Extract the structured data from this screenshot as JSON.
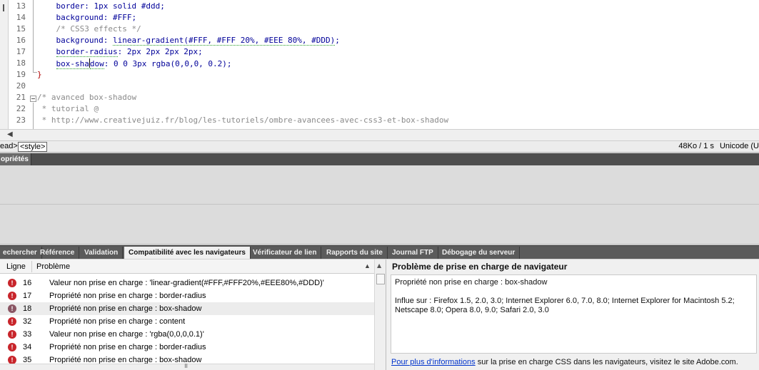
{
  "editor": {
    "line_numbers": [
      "13",
      "14",
      "15",
      "16",
      "17",
      "18",
      "19",
      "20",
      "21",
      "22",
      "23"
    ],
    "lines": {
      "l13": {
        "prop": "border",
        "rest": ": 1px solid #ddd;"
      },
      "l14": {
        "prop": "background",
        "rest": ": #FFF;"
      },
      "l15": {
        "comment": "/* CSS3 effects */"
      },
      "l16": {
        "prop": "background",
        "sep": ": ",
        "squiggle": "linear-gradient(#FFF, #FFF 20%, #EEE 80%, #DDD)",
        "end": ";"
      },
      "l17": {
        "prop": "border-radius",
        "rest": ": 2px 2px 2px 2px;"
      },
      "l18": {
        "prop_a": "box-sha",
        "prop_b": "dow",
        "rest": ": 0 0 3px rgba(0,0,0, 0.2);"
      },
      "l19": {
        "brace": "}"
      },
      "l21": {
        "comment": "/* avanced box-shadow"
      },
      "l22": {
        "comment": " * tutorial @"
      },
      "l23": {
        "comment": " * http://www.creativejuiz.fr/blog/les-tutoriels/ombre-avancees-avec-css3-et-box-shadow"
      }
    }
  },
  "statusbar": {
    "tag_head": "ead>",
    "tag_style": "<style>",
    "size": "48Ko / 1 s",
    "encoding": "Unicode (U"
  },
  "properties": {
    "tab_label": "opriétés"
  },
  "results": {
    "tabs": [
      "echercher",
      "Référence",
      "Validation",
      "Compatibilité avec les navigateurs",
      "Vérificateur de lien",
      "Rapports du site",
      "Journal FTP",
      "Débogage du serveur"
    ],
    "active_tab": "Compatibilité avec les navigateurs",
    "columns": {
      "line": "Ligne",
      "problem": "Problème"
    },
    "rows": [
      {
        "line": "16",
        "message": "Valeur non prise en charge : 'linear-gradient(#FFF,#FFF20%,#EEE80%,#DDD)'"
      },
      {
        "line": "17",
        "message": "Propriété non prise en charge : border-radius"
      },
      {
        "line": "18",
        "message": "Propriété non prise en charge : box-shadow"
      },
      {
        "line": "32",
        "message": "Propriété non prise en charge : content"
      },
      {
        "line": "33",
        "message": "Valeur non prise en charge : 'rgba(0,0,0,0.1)'"
      },
      {
        "line": "34",
        "message": "Propriété non prise en charge : border-radius"
      },
      {
        "line": "35",
        "message": "Propriété non prise en charge : box-shadow"
      }
    ],
    "error_glyph": "!",
    "hscroll_grip": "III"
  },
  "detail": {
    "title": "Problème de prise en charge de navigateur",
    "property": "Propriété non prise en charge : box-shadow",
    "affects": "Influe sur : Firefox 1.5, 2.0, 3.0; Internet Explorer 6.0, 7.0, 8.0; Internet Explorer for Macintosh 5.2; Netscape 8.0; Opera 8.0, 9.0; Safari 2.0, 3.0",
    "footer_link": "Pour plus d'informations",
    "footer_rest": " sur la prise en charge CSS dans les navigateurs, visitez le site Adobe.com."
  },
  "colors": {
    "error_red": "#c8252b",
    "panel_dark": "#5b5b5b",
    "link_blue": "#0033cc"
  },
  "icons": {
    "error": "error-icon",
    "scroll_left": "arrow-left-icon",
    "scroll_up": "arrow-up-icon",
    "sort": "sort-arrow-icon"
  }
}
